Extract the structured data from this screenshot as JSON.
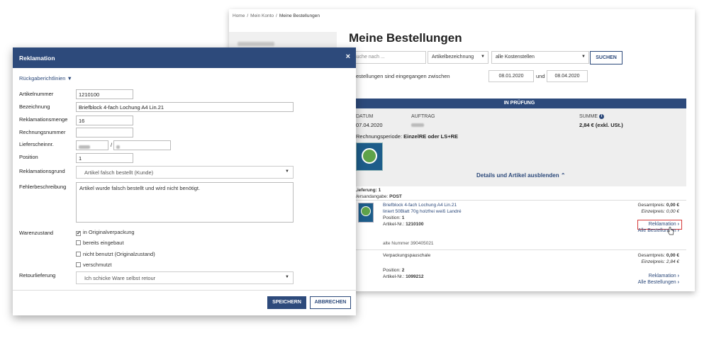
{
  "breadcrumb": [
    "Home",
    "Mein Konto",
    "Meine Bestellungen"
  ],
  "page_title": "Meine Bestellungen",
  "search": {
    "placeholder": "Suche nach ...",
    "field_select": "Artikelbezeichnung",
    "cost_select": "alle Kostenstellen",
    "button": "SUCHEN"
  },
  "dates": {
    "label": "Bestellungen sind eingegangen zwischen",
    "from": "08.01.2020",
    "und": "und",
    "to": "08.04.2020"
  },
  "order": {
    "status": "IN PRÜFUNG",
    "datum_label": "DATUM",
    "datum": "07.04.2020",
    "auftrag_label": "AUFTRAG",
    "summe_label": "SUMME",
    "summe": "2,84 € (exkl. USt.)",
    "periode_label": "Rechnungsperiode:",
    "periode": "EinzelRE oder LS+RE",
    "details_link": "Details und Artikel ausblenden"
  },
  "lieferung": {
    "label": "Lieferung: 1",
    "versand_label": "Versandangabe:",
    "versand": "POST",
    "items": [
      {
        "name_line1": "Briefblock 4-fach Lochung A4 Lin.21",
        "name_line2": "liniert 50Blatt 70g holzfrei weiß Landré",
        "position_label": "Position:",
        "position": "1",
        "artikel_label": "Artikel-Nr.:",
        "artikel": "1210100",
        "alte_nummer": "alte Nummer 390405021",
        "gesamt_label": "Gesamtpreis:",
        "gesamt": "0,00 €",
        "einzel_label": "Einzelpreis:",
        "einzel": "0,00 €",
        "reklamation": "Reklamation",
        "alle": "Alle Bestellungen"
      },
      {
        "name_line1": "Verpackungspauschale",
        "position_label": "Position:",
        "position": "2",
        "artikel_label": "Artikel-Nr.:",
        "artikel": "1099212",
        "gesamt_label": "Gesamtpreis:",
        "gesamt": "0,00 €",
        "einzel_label": "Einzelpreis:",
        "einzel": "2,84 €",
        "reklamation": "Reklamation",
        "alle": "Alle Bestellungen"
      }
    ]
  },
  "modal": {
    "title": "Reklamation",
    "close": "×",
    "rueck": "Rückgaberichtlinien",
    "fields": {
      "artikelnummer_label": "Artikelnummer",
      "artikelnummer": "1210100",
      "bezeichnung_label": "Bezeichnung",
      "bezeichnung": "Briefblock 4-fach Lochung A4 Lin.21",
      "menge_label": "Reklamationsmenge",
      "menge": "16",
      "rechnung_label": "Rechnungsnummer",
      "rechnung": "",
      "lieferschein_label": "Lieferscheinnr.",
      "lieferschein_sep": "/",
      "position_label": "Position",
      "position": "1",
      "grund_label": "Reklamationsgrund",
      "grund": "Artikel falsch bestellt (Kunde)",
      "fehler_label": "Fehlerbeschreibung",
      "fehler": "Artikel wurde falsch bestellt und wird nicht benötigt.",
      "waren_label": "Warenzustand",
      "retour_label": "Retourlieferung",
      "retour": "Ich schicke Ware selbst retour"
    },
    "zustand": [
      {
        "label": "in Originalverpackung",
        "checked": "✔"
      },
      {
        "label": "bereits eingebaut",
        "checked": ""
      },
      {
        "label": "nicht benutzt (Originalzustand)",
        "checked": ""
      },
      {
        "label": "verschmutzt",
        "checked": ""
      }
    ],
    "save": "SPEICHERN",
    "cancel": "ABBRECHEN"
  },
  "colors": {
    "primary": "#2d4a7b",
    "highlight": "#d63a3a"
  }
}
